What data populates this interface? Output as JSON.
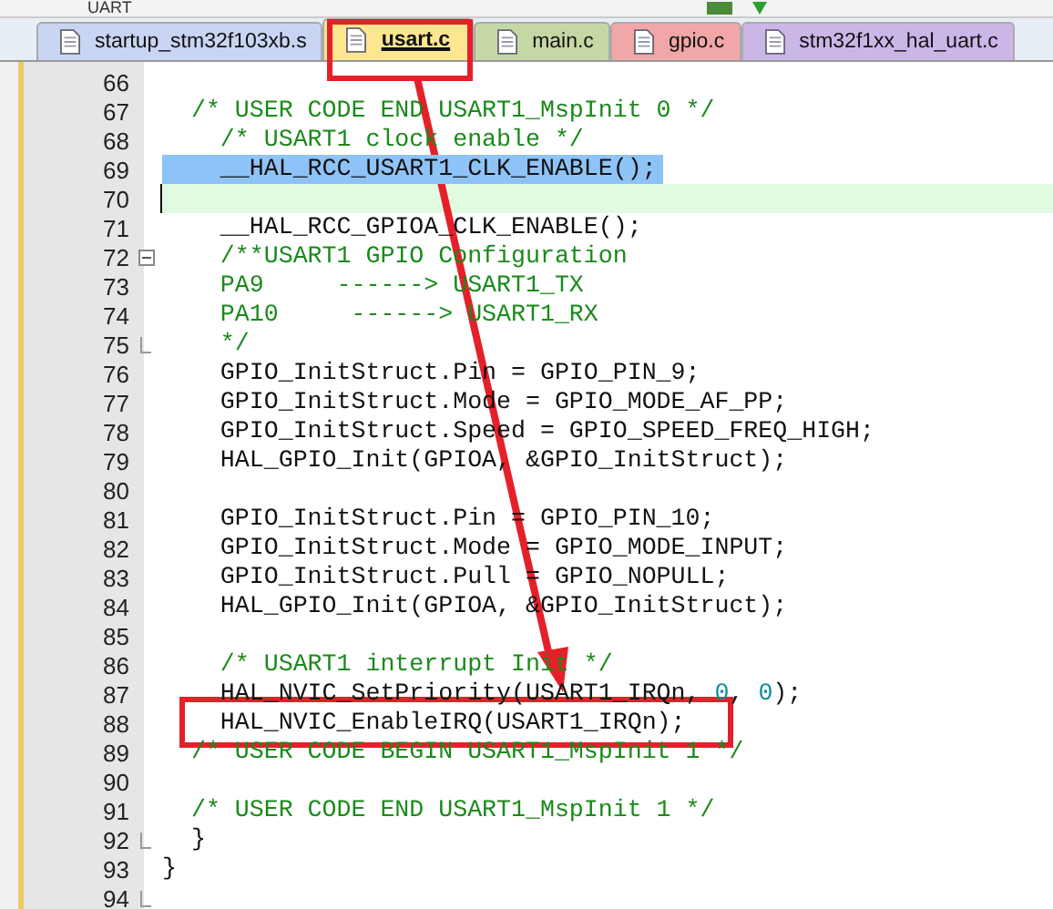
{
  "toolbar": {
    "target": "UART"
  },
  "tabs": [
    {
      "label": "startup_stm32f103xb.s",
      "selected": false,
      "color": "#c9d5f2"
    },
    {
      "label": "usart.c",
      "selected": true,
      "color": "#fde68f"
    },
    {
      "label": "main.c",
      "selected": false,
      "color": "#c6d7a6"
    },
    {
      "label": "gpio.c",
      "selected": false,
      "color": "#f1a7a7"
    },
    {
      "label": "stm32f1xx_hal_uart.c",
      "selected": false,
      "color": "#cbb6e8"
    }
  ],
  "lines": [
    {
      "number": "66",
      "current": false,
      "collapsible": false,
      "fold_end": false
    },
    {
      "number": "67",
      "selected": false,
      "current": false,
      "collapsible": false,
      "fold_end": false,
      "parts": [
        {
          "text": "  /* USER CODE END USART1_MspInit 0 */",
          "kind": "comment"
        }
      ]
    },
    {
      "number": "68",
      "selected": false,
      "current": false,
      "collapsible": false,
      "fold_end": false,
      "parts": [
        {
          "text": "    /* USART1 clock enable */",
          "kind": "comment"
        }
      ]
    },
    {
      "number": "69",
      "selected": true,
      "current": false,
      "collapsible": false,
      "fold_end": false,
      "parts": [
        {
          "text": "    __HAL_RCC_USART1_CLK_ENABLE();",
          "kind": "code"
        }
      ]
    },
    {
      "number": "70",
      "current": true,
      "collapsible": false,
      "fold_end": false
    },
    {
      "number": "71",
      "selected": false,
      "current": false,
      "collapsible": false,
      "fold_end": false,
      "parts": [
        {
          "text": "    __HAL_RCC_GPIOA_CLK_ENABLE();",
          "kind": "code"
        }
      ]
    },
    {
      "number": "72",
      "selected": false,
      "current": false,
      "collapsible": true,
      "fold_end": false,
      "parts": [
        {
          "text": "    /**USART1 GPIO Configuration",
          "kind": "comment"
        }
      ]
    },
    {
      "number": "73",
      "selected": false,
      "current": false,
      "collapsible": false,
      "fold_end": false,
      "parts": [
        {
          "text": "    PA9     ------> USART1_TX",
          "kind": "comment"
        }
      ]
    },
    {
      "number": "74",
      "selected": false,
      "current": false,
      "collapsible": false,
      "fold_end": false,
      "parts": [
        {
          "text": "    PA10     ------> USART1_RX",
          "kind": "comment"
        }
      ]
    },
    {
      "number": "75",
      "selected": false,
      "current": false,
      "collapsible": false,
      "fold_end": true,
      "parts": [
        {
          "text": "    */",
          "kind": "comment"
        }
      ]
    },
    {
      "number": "76",
      "selected": false,
      "current": false,
      "collapsible": false,
      "fold_end": false,
      "parts": [
        {
          "text": "    GPIO_InitStruct.Pin = GPIO_PIN_9;",
          "kind": "code"
        }
      ]
    },
    {
      "number": "77",
      "selected": false,
      "current": false,
      "collapsible": false,
      "fold_end": false,
      "parts": [
        {
          "text": "    GPIO_InitStruct.Mode = GPIO_MODE_AF_PP;",
          "kind": "code"
        }
      ]
    },
    {
      "number": "78",
      "selected": false,
      "current": false,
      "collapsible": false,
      "fold_end": false,
      "parts": [
        {
          "text": "    GPIO_InitStruct.Speed = GPIO_SPEED_FREQ_HIGH;",
          "kind": "code"
        }
      ]
    },
    {
      "number": "79",
      "selected": false,
      "current": false,
      "collapsible": false,
      "fold_end": false,
      "parts": [
        {
          "text": "    HAL_GPIO_Init(GPIOA, &GPIO_InitStruct);",
          "kind": "code"
        }
      ]
    },
    {
      "number": "80",
      "current": false,
      "collapsible": false,
      "fold_end": false
    },
    {
      "number": "81",
      "selected": false,
      "current": false,
      "collapsible": false,
      "fold_end": false,
      "parts": [
        {
          "text": "    GPIO_InitStruct.Pin = GPIO_PIN_10;",
          "kind": "code"
        }
      ]
    },
    {
      "number": "82",
      "selected": false,
      "current": false,
      "collapsible": false,
      "fold_end": false,
      "parts": [
        {
          "text": "    GPIO_InitStruct.Mode = GPIO_MODE_INPUT;",
          "kind": "code"
        }
      ]
    },
    {
      "number": "83",
      "selected": false,
      "current": false,
      "collapsible": false,
      "fold_end": false,
      "parts": [
        {
          "text": "    GPIO_InitStruct.Pull = GPIO_NOPULL;",
          "kind": "code"
        }
      ]
    },
    {
      "number": "84",
      "selected": false,
      "current": false,
      "collapsible": false,
      "fold_end": false,
      "parts": [
        {
          "text": "    HAL_GPIO_Init(GPIOA, &GPIO_InitStruct);",
          "kind": "code"
        }
      ]
    },
    {
      "number": "85",
      "current": false,
      "collapsible": false,
      "fold_end": false
    },
    {
      "number": "86",
      "selected": false,
      "current": false,
      "collapsible": false,
      "fold_end": false,
      "parts": [
        {
          "text": "    /* USART1 interrupt Init */",
          "kind": "comment"
        }
      ]
    },
    {
      "number": "87",
      "selected": false,
      "current": false,
      "collapsible": false,
      "fold_end": false,
      "parts": [
        {
          "text": "    HAL_NVIC_SetPriority(USART1_IRQn, ",
          "kind": "code"
        },
        {
          "text": "0",
          "kind": "number"
        },
        {
          "text": ", ",
          "kind": "code"
        },
        {
          "text": "0",
          "kind": "number"
        },
        {
          "text": ");",
          "kind": "code"
        }
      ]
    },
    {
      "number": "88",
      "selected": false,
      "current": false,
      "collapsible": false,
      "fold_end": false,
      "parts": [
        {
          "text": "    HAL_NVIC_EnableIRQ(USART1_IRQn);",
          "kind": "code"
        }
      ]
    },
    {
      "number": "89",
      "selected": false,
      "current": false,
      "collapsible": false,
      "fold_end": false,
      "parts": [
        {
          "text": "  /* USER CODE BEGIN USART1_MspInit 1 */",
          "kind": "comment"
        }
      ]
    },
    {
      "number": "90",
      "current": false,
      "collapsible": false,
      "fold_end": false
    },
    {
      "number": "91",
      "selected": false,
      "current": false,
      "collapsible": false,
      "fold_end": false,
      "parts": [
        {
          "text": "  /* USER CODE END USART1_MspInit 1 */",
          "kind": "comment"
        }
      ]
    },
    {
      "number": "92",
      "selected": false,
      "current": false,
      "collapsible": false,
      "fold_end": true,
      "parts": [
        {
          "text": "  }",
          "kind": "code"
        }
      ]
    },
    {
      "number": "93",
      "selected": false,
      "current": false,
      "collapsible": false,
      "fold_end": false,
      "parts": [
        {
          "text": "}",
          "kind": "code"
        }
      ]
    },
    {
      "number": "94",
      "current": false,
      "collapsible": false,
      "fold_end": true
    }
  ]
}
